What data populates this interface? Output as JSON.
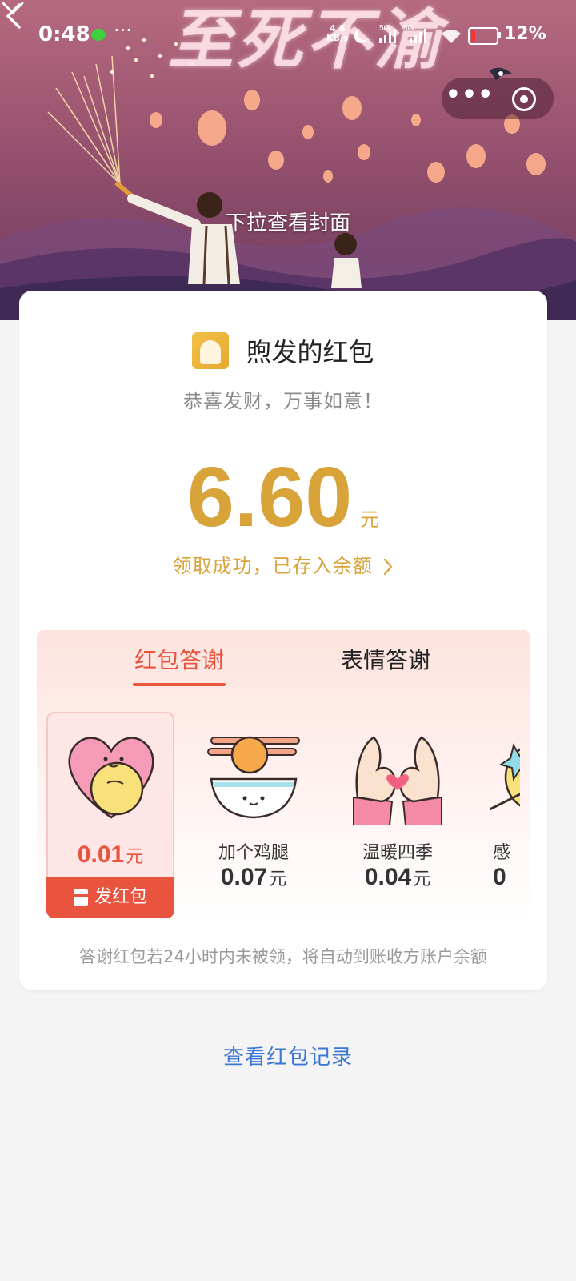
{
  "status_bar": {
    "time": "0:48",
    "more": "···",
    "net_speed_value": "4.8",
    "net_speed_unit": "KB/s",
    "signal_1": "5G",
    "signal_2": "5G",
    "battery": "12%"
  },
  "banner": {
    "cover_title": "至死不渝",
    "pull_hint": "下拉查看封面",
    "capsule_more": "•••"
  },
  "card": {
    "sender": "煦发的红包",
    "blessing": "恭喜发财，万事如意！",
    "amount": "6.60",
    "amount_unit": "元",
    "claim_status": "领取成功，已存入余额"
  },
  "thanks": {
    "tabs": [
      {
        "label": "红包答谢",
        "active": true
      },
      {
        "label": "表情答谢",
        "active": false
      }
    ],
    "items": [
      {
        "name": "",
        "price": "0.01",
        "unit": "元",
        "selected": true,
        "icon": "heart-hug-icon"
      },
      {
        "name": "加个鸡腿",
        "price": "0.07",
        "unit": "元",
        "selected": false,
        "icon": "rice-bowl-drumstick-icon"
      },
      {
        "name": "温暖四季",
        "price": "0.04",
        "unit": "元",
        "selected": false,
        "icon": "heart-hands-icon"
      },
      {
        "name": "感",
        "price": "0",
        "unit": "",
        "selected": false,
        "icon": "star-fruit-icon"
      }
    ],
    "send_button": "发红包",
    "footnote": "答谢红包若24小时内未被领，将自动到账收方账户余额"
  },
  "records_link": "查看红包记录",
  "colors": {
    "accent_red": "#e8543e",
    "gold": "#d8a43a",
    "link_blue": "#3a76d4"
  }
}
